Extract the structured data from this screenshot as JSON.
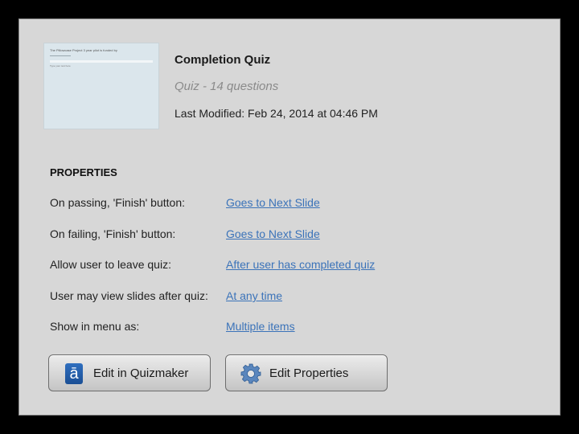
{
  "thumbnail": {
    "title": "The Pillowcase Project 3 year pilot is funded by",
    "caption": "Type your text here"
  },
  "header": {
    "title": "Completion Quiz",
    "subtitle": "Quiz - 14 questions",
    "modified": "Last Modified: Feb 24, 2014 at 04:46 PM"
  },
  "properties": {
    "heading": "PROPERTIES",
    "items": [
      {
        "label": "On passing, 'Finish' button:",
        "value": "Goes to Next Slide"
      },
      {
        "label": "On failing, 'Finish' button:",
        "value": "Goes to Next Slide"
      },
      {
        "label": "Allow user to leave quiz:",
        "value": "After user has completed quiz"
      },
      {
        "label": "User may view slides after quiz:",
        "value": "At any time"
      },
      {
        "label": "Show in menu as:",
        "value": "Multiple items"
      }
    ]
  },
  "buttons": {
    "edit_quizmaker": "Edit in Quizmaker",
    "quizmaker_icon_glyph": "ā",
    "edit_properties": "Edit Properties"
  },
  "icons": {
    "quizmaker": "quizmaker-icon",
    "settings": "gear-icon"
  },
  "colors": {
    "link": "#3b73b9",
    "panel": "#d7d7d7",
    "quizmaker_icon": "#2f6fbf"
  }
}
